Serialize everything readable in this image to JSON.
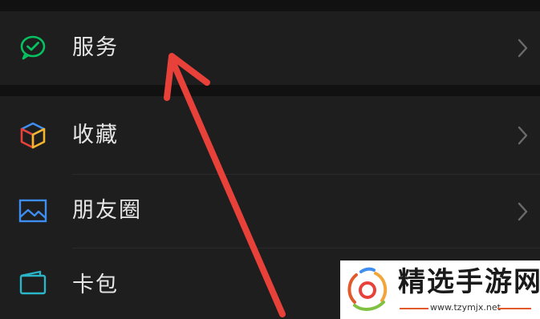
{
  "menu": {
    "items": [
      {
        "label": "服务",
        "icon": "wechat-pay-check-icon",
        "has_chevron": true
      },
      {
        "label": "收藏",
        "icon": "cube-icon",
        "has_chevron": true
      },
      {
        "label": "朋友圈",
        "icon": "picture-icon",
        "has_chevron": true
      },
      {
        "label": "卡包",
        "icon": "wallet-icon",
        "has_chevron": false
      }
    ]
  },
  "colors": {
    "background": "#111111",
    "row": "#1e1e1e",
    "text": "#e6e6e6",
    "chevron": "#6b6b6b",
    "annotation_arrow": "#e8413a",
    "services_icon": "#07c160",
    "picture_icon": "#3d8ef0",
    "wallet_icon": "#2bb5c9"
  },
  "watermark": {
    "title": "精选手游网",
    "url": "www.tzymjx.net"
  }
}
